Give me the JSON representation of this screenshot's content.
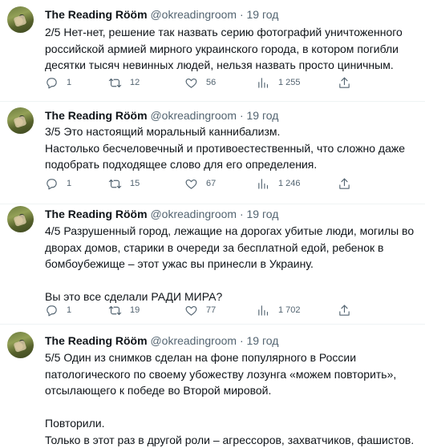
{
  "tweets": [
    {
      "name": "The Reading Rööm",
      "handle": "@okreadingroom",
      "dot": "·",
      "time": "19 год",
      "text": "2/5  Нет-нет, решение так назвать серию фотографий уничтоженного российской армией мирного украинского города, в котором погибли десятки тысяч невинных людей, нельзя назвать просто циничным.",
      "replies": "1",
      "retweets": "12",
      "likes": "56",
      "views": "1 255"
    },
    {
      "name": "The Reading Rööm",
      "handle": "@okreadingroom",
      "dot": "·",
      "time": "19 год",
      "text": "3/5  Это настоящий моральный каннибализм.\nНастолько бесчеловечный и противоестественный, что сложно даже подобрать подходящее слово для его определения.",
      "replies": "1",
      "retweets": "15",
      "likes": "67",
      "views": "1 246"
    },
    {
      "name": "The Reading Rööm",
      "handle": "@okreadingroom",
      "dot": "·",
      "time": "19 год",
      "text": "4/5  Разрушенный город, лежащие на дорогах убитые люди, могилы во дворах домов, старики в очереди за бесплатной едой, ребенок в бомбоубежище – этот ужас вы принесли в Украину.\n\nВы это все сделали РАДИ МИРА?",
      "replies": "1",
      "retweets": "19",
      "likes": "77",
      "views": "1 702"
    },
    {
      "name": "The Reading Rööm",
      "handle": "@okreadingroom",
      "dot": "·",
      "time": "19 год",
      "text": "5/5  Один из снимков сделан на фоне популярного в России патологического по своему убожеству лозунга «можем повторить», отсылающего к победе во Второй мировой.\n\nПовторили.\nТолько в этот раз в другой роли – агрессоров, захватчиков, фашистов."
    }
  ],
  "icons": {
    "reply": "reply-icon",
    "retweet": "retweet-icon",
    "like": "heart-icon",
    "views": "views-icon",
    "share": "share-icon"
  },
  "colors": {
    "text": "#0f1419",
    "secondary": "#536471",
    "divider": "#eff3f4"
  }
}
